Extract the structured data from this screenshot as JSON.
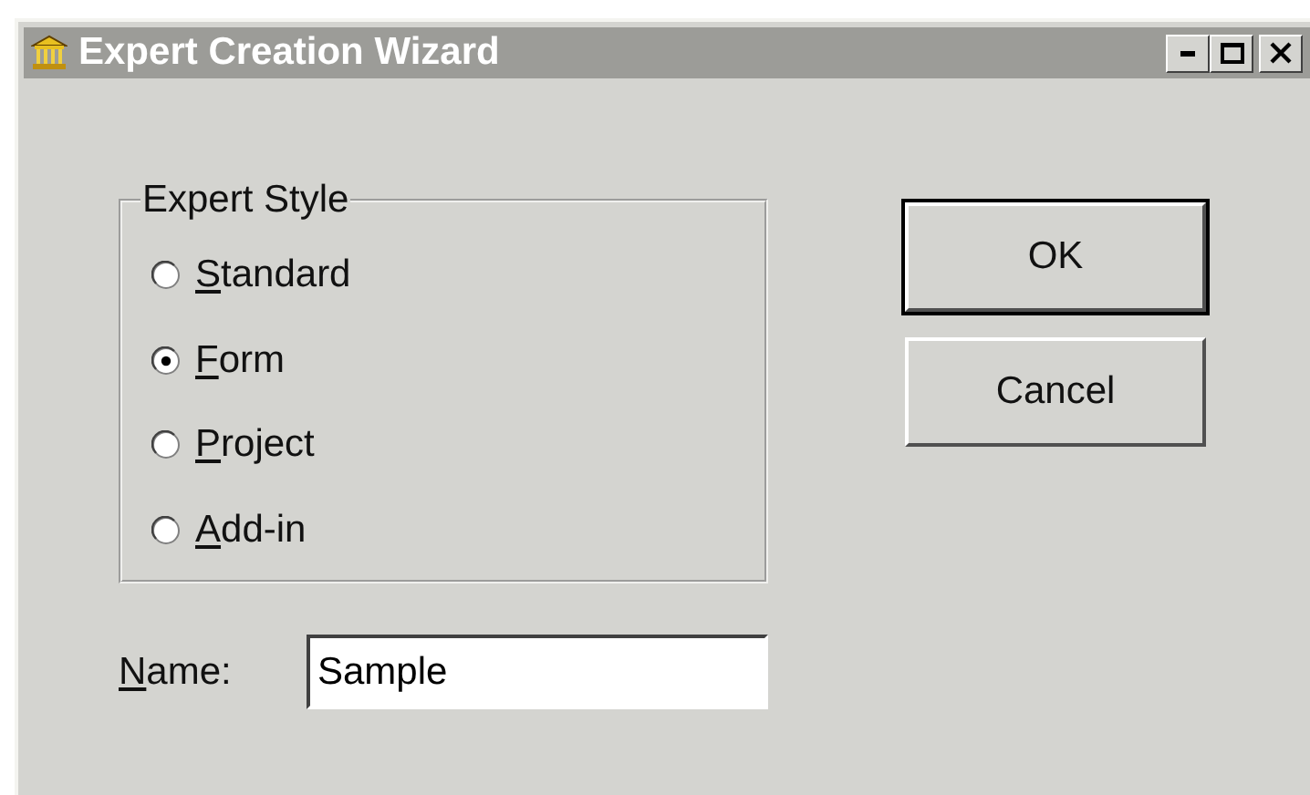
{
  "window": {
    "title": "Expert Creation Wizard",
    "controls": [
      {
        "kind": "minimize"
      },
      {
        "kind": "maximize"
      },
      {
        "kind": "close"
      }
    ]
  },
  "group": {
    "title": "Expert Style",
    "options": [
      {
        "label": "Standard",
        "selected": false
      },
      {
        "label": "Form",
        "selected": true
      },
      {
        "label": "Project",
        "selected": false
      },
      {
        "label": "Add-in",
        "selected": false
      }
    ]
  },
  "name_field": {
    "label": "Name:",
    "value": "Sample"
  },
  "buttons": [
    {
      "label": "OK",
      "default": true
    },
    {
      "label": "Cancel",
      "default": false
    }
  ]
}
